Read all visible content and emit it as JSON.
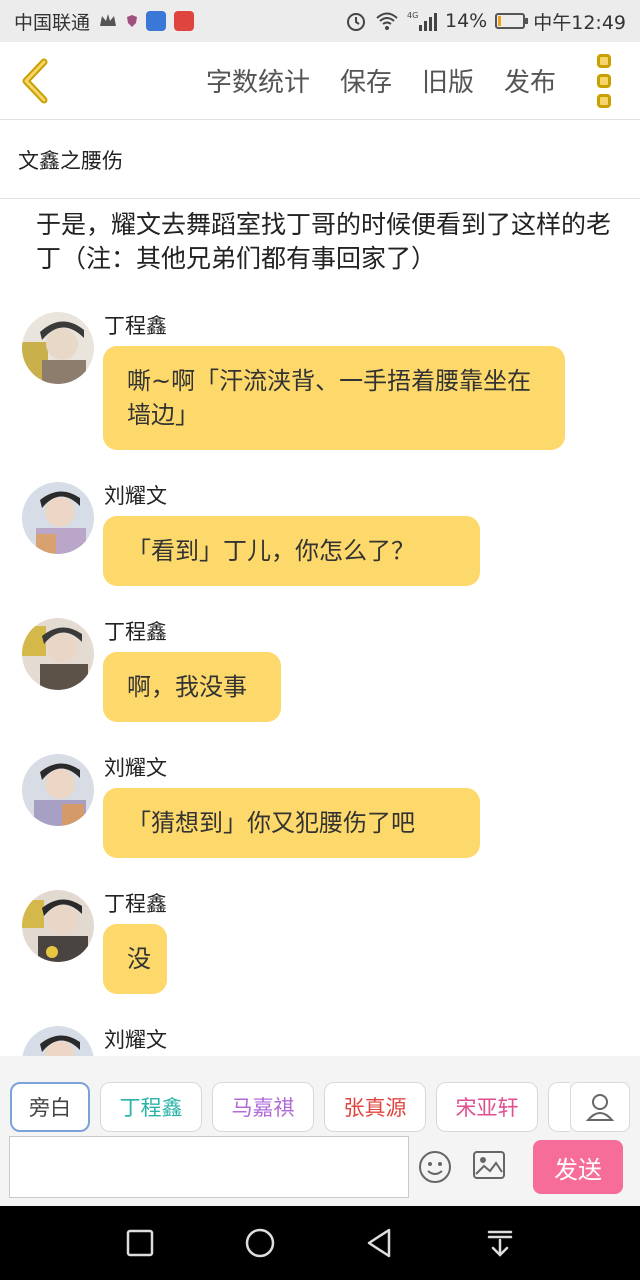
{
  "status_bar": {
    "carrier": "中国联通",
    "battery_percent_text": "14%",
    "battery_level": 0.14,
    "network": "4G",
    "time": "中午12:49"
  },
  "toolbar": {
    "actions": [
      "字数统计",
      "保存",
      "旧版",
      "发布"
    ]
  },
  "chapter_title": "文鑫之腰伤",
  "narration": "于是，耀文去舞蹈室找丁哥的时候便看到了这样的老丁（注：其他兄弟们都有事回家了）",
  "messages": [
    {
      "speaker": "丁程鑫",
      "text": "嘶~啊「汗流浃背、一手捂着腰靠坐在墙边」"
    },
    {
      "speaker": "刘耀文",
      "text": "「看到」丁儿，你怎么了？"
    },
    {
      "speaker": "丁程鑫",
      "text": "啊，我没事"
    },
    {
      "speaker": "刘耀文",
      "text": "「猜想到」你又犯腰伤了吧"
    },
    {
      "speaker": "丁程鑫",
      "text": "没"
    },
    {
      "speaker": "刘耀文",
      "text": ""
    }
  ],
  "roles": [
    {
      "label": "旁白",
      "color": "#444444"
    },
    {
      "label": "丁程鑫",
      "color": "#2bb3a8"
    },
    {
      "label": "马嘉祺",
      "color": "#b06bd6"
    },
    {
      "label": "张真源",
      "color": "#e0443e"
    },
    {
      "label": "宋亚轩",
      "color": "#e04f8f"
    }
  ],
  "input": {
    "value": "",
    "placeholder": ""
  },
  "send_label": "发送",
  "colors": {
    "bubble": "#fdd96b",
    "send": "#f76d9a",
    "accent": "#c8a000"
  }
}
